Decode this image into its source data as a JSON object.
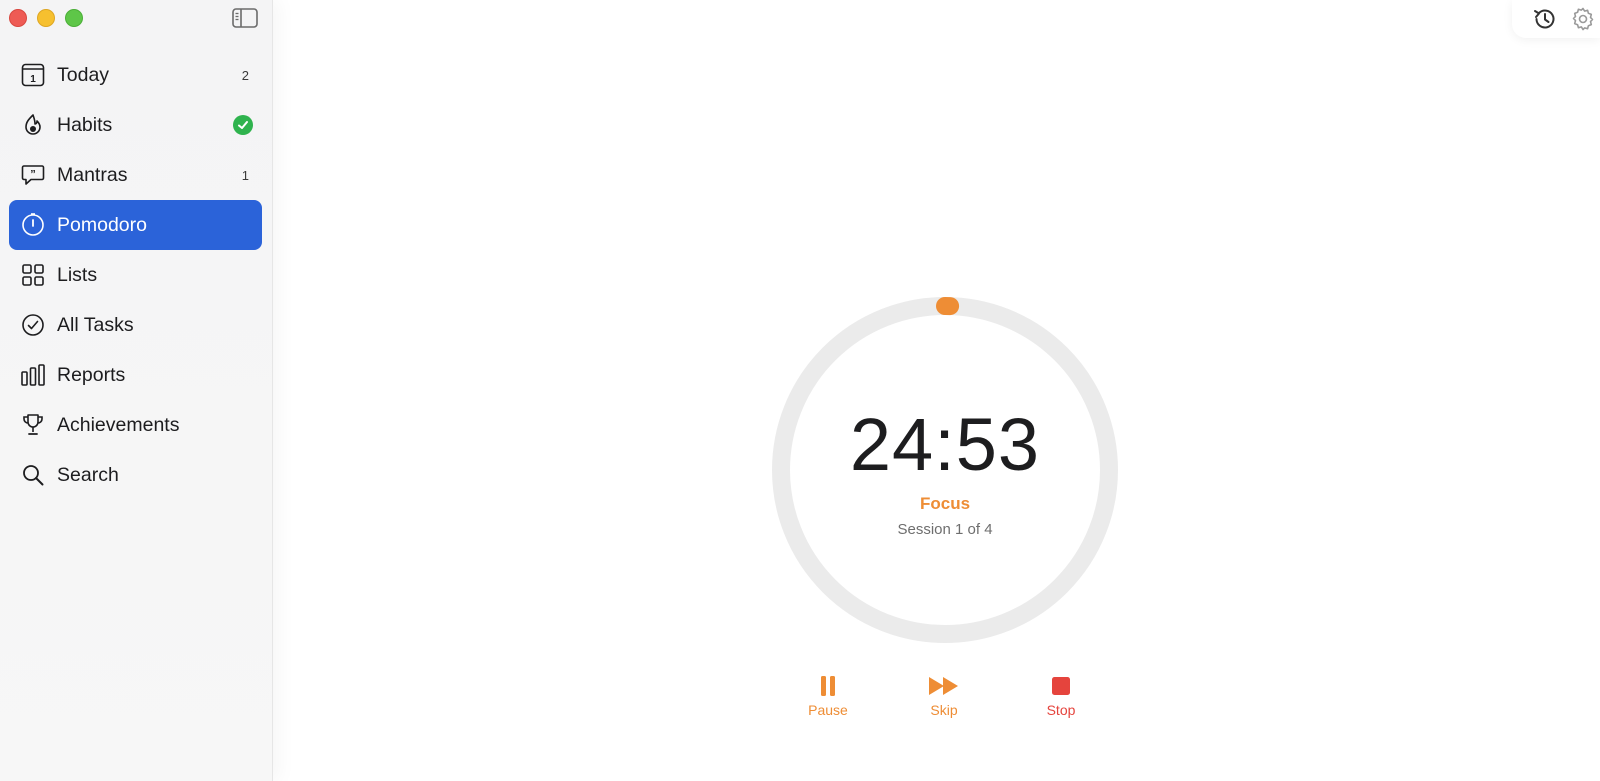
{
  "window": {
    "controls": [
      "close",
      "minimize",
      "zoom"
    ]
  },
  "sidebar": {
    "items": [
      {
        "label": "Today",
        "icon": "calendar-icon",
        "count": "2"
      },
      {
        "label": "Habits",
        "icon": "flame-icon",
        "badge": "check"
      },
      {
        "label": "Mantras",
        "icon": "quote-bubble-icon",
        "count": "1"
      },
      {
        "label": "Pomodoro",
        "icon": "timer-icon",
        "active": true
      },
      {
        "label": "Lists",
        "icon": "grid-icon"
      },
      {
        "label": "All Tasks",
        "icon": "check-circle-icon"
      },
      {
        "label": "Reports",
        "icon": "bar-chart-icon"
      },
      {
        "label": "Achievements",
        "icon": "trophy-icon"
      },
      {
        "label": "Search",
        "icon": "search-icon"
      }
    ]
  },
  "toolbar": {
    "icons": [
      "history-icon",
      "gear-icon"
    ]
  },
  "pomodoro": {
    "time": "24:53",
    "phase": "Focus",
    "session": "Session 1 of 4",
    "progress": 0.005,
    "controls": {
      "pause": "Pause",
      "skip": "Skip",
      "stop": "Stop"
    }
  },
  "colors": {
    "accent": "#ee8d35",
    "active_nav": "#2b63d9",
    "stop": "#e5443d",
    "ring_track": "#ebebeb",
    "habit_check": "#2fb34e"
  }
}
